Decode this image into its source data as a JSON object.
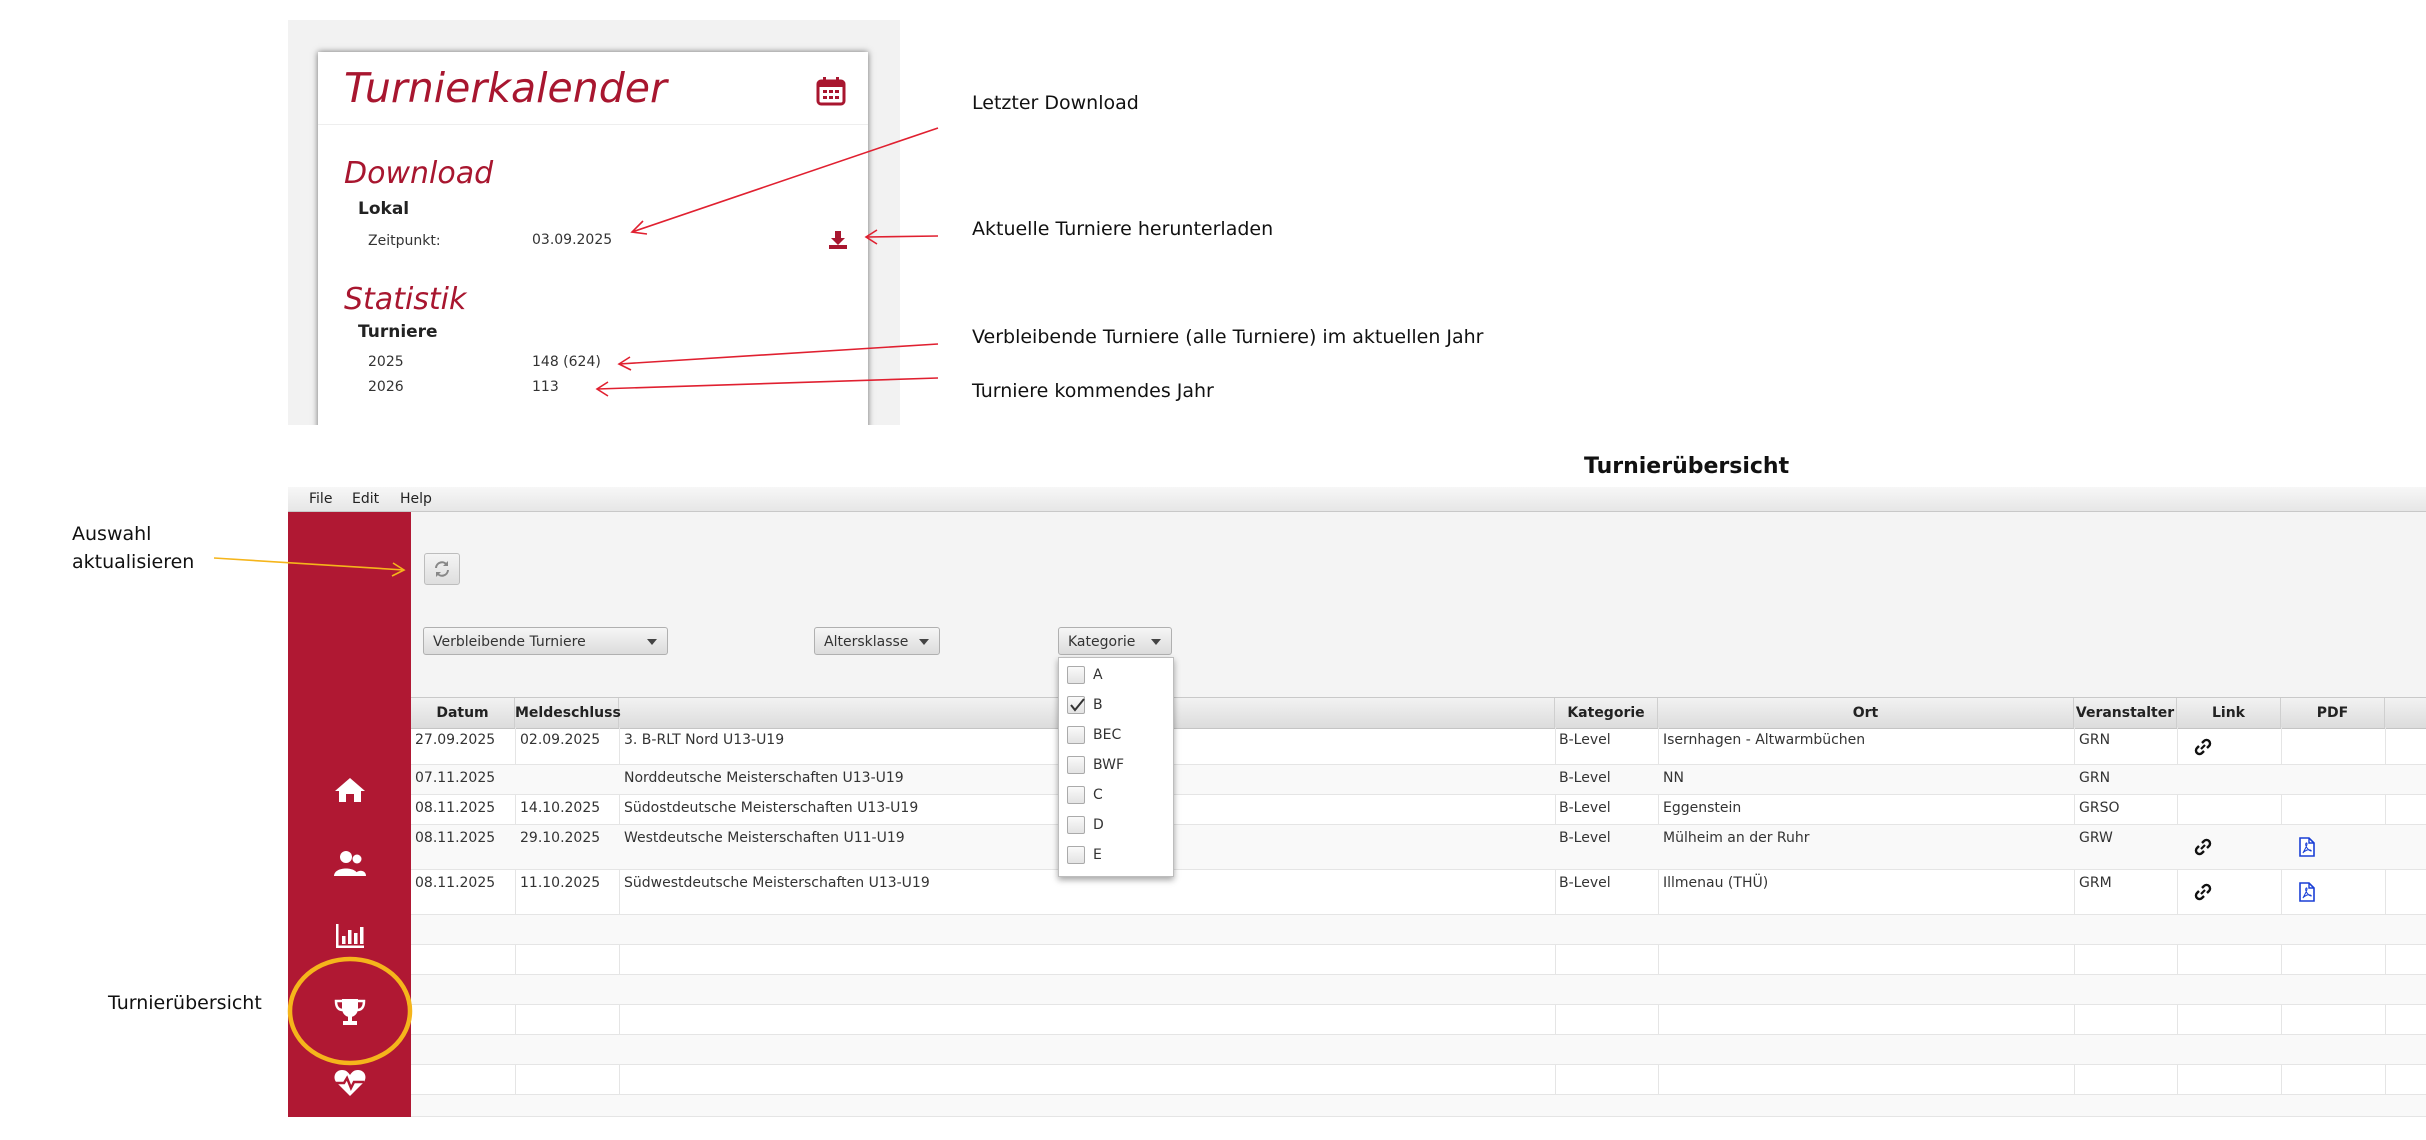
{
  "card": {
    "title": "Turnierkalender",
    "download": {
      "title": "Download",
      "section": "Lokal",
      "time_label": "Zeitpunkt:",
      "time_value": "03.09.2025"
    },
    "stats": {
      "title": "Statistik",
      "section": "Turniere",
      "rows": [
        {
          "year": "2025",
          "value": "148 (624)"
        },
        {
          "year": "2026",
          "value": "113"
        }
      ]
    }
  },
  "annotations": {
    "last_download": "Letzter Download",
    "download_current": "Aktuelle Turniere herunterladen",
    "remaining": "Verbleibende Turniere (alle Turniere) im aktuellen Jahr",
    "next_year": "Turniere kommendes Jahr",
    "refresh_line1": "Auswahl",
    "refresh_line2": "aktualisieren",
    "overview": "Turnierübersicht"
  },
  "section_title": "Turnierübersicht",
  "menu": [
    "File",
    "Edit",
    "Help"
  ],
  "filters": {
    "tournaments": "Verbleibende Turniere",
    "age_class": "Altersklasse",
    "category": "Kategorie"
  },
  "category_options": [
    {
      "label": "A",
      "checked": false
    },
    {
      "label": "B",
      "checked": true
    },
    {
      "label": "BEC",
      "checked": false
    },
    {
      "label": "BWF",
      "checked": false
    },
    {
      "label": "C",
      "checked": false
    },
    {
      "label": "D",
      "checked": false
    },
    {
      "label": "E",
      "checked": false
    }
  ],
  "table": {
    "columns": [
      "Datum",
      "Meldeschluss",
      "",
      "Kategorie",
      "Ort",
      "Veranstalter",
      "Link",
      "PDF"
    ],
    "rows": [
      {
        "datum": "27.09.2025",
        "meldeschluss": "02.09.2025",
        "name": "3. B-RLT Nord U13-U19",
        "kategorie": "B-Level",
        "ort": "Isernhagen - Altwarmbüchen",
        "veranstalter": "GRN",
        "link": true,
        "pdf": false
      },
      {
        "datum": "07.11.2025",
        "meldeschluss": "",
        "name": "Norddeutsche Meisterschaften U13-U19",
        "kategorie": "B-Level",
        "ort": "NN",
        "veranstalter": "GRN",
        "link": false,
        "pdf": false
      },
      {
        "datum": "08.11.2025",
        "meldeschluss": "14.10.2025",
        "name": "Südostdeutsche Meisterschaften U13-U19",
        "kategorie": "B-Level",
        "ort": "Eggenstein",
        "veranstalter": "GRSO",
        "link": false,
        "pdf": false
      },
      {
        "datum": "08.11.2025",
        "meldeschluss": "29.10.2025",
        "name": "Westdeutsche Meisterschaften U11-U19",
        "kategorie": "B-Level",
        "ort": "Mülheim an der Ruhr",
        "veranstalter": "GRW",
        "link": true,
        "pdf": true
      },
      {
        "datum": "08.11.2025",
        "meldeschluss": "11.10.2025",
        "name": "Südwestdeutsche Meisterschaften U13-U19",
        "kategorie": "B-Level",
        "ort": "Illmenau (THÜ)",
        "veranstalter": "GRM",
        "link": true,
        "pdf": true
      }
    ]
  },
  "colors": {
    "brand": "#b01833",
    "highlight": "#f5b51b",
    "arrow": "#e02030"
  }
}
